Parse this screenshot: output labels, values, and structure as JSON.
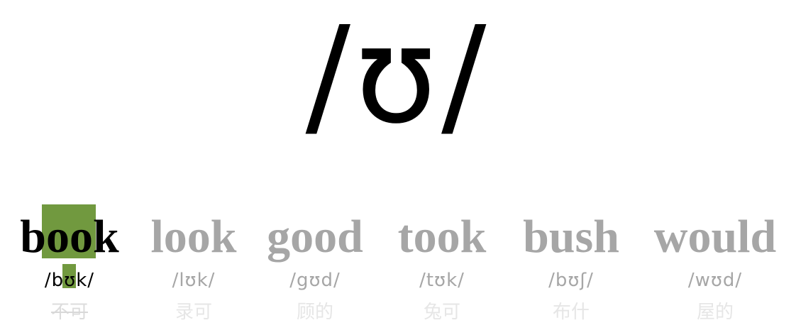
{
  "phoneme": "/ʊ/",
  "highlight_color": "#71993f",
  "words": [
    {
      "word": "book",
      "ipa": "/bʊk/",
      "hint": "不可",
      "active": true
    },
    {
      "word": "look",
      "ipa": "/lʊk/",
      "hint": "录可",
      "active": false
    },
    {
      "word": "good",
      "ipa": "/gʊd/",
      "hint": "顾的",
      "active": false
    },
    {
      "word": "took",
      "ipa": "/tʊk/",
      "hint": "兔可",
      "active": false
    },
    {
      "word": "bush",
      "ipa": "/bʊʃ/",
      "hint": "布什",
      "active": false
    },
    {
      "word": "would",
      "ipa": "/wʊd/",
      "hint": "屋的",
      "active": false
    }
  ]
}
